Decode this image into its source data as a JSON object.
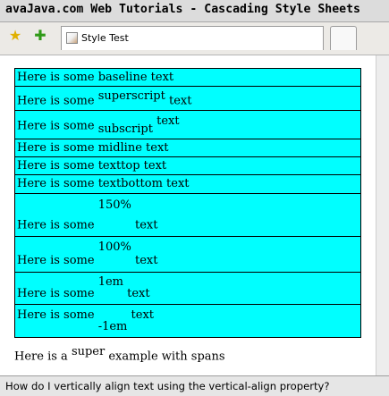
{
  "window": {
    "title": "avaJava.com Web Tutorials - Cascading Style Sheets"
  },
  "toolbar": {
    "star_icon": "star-icon",
    "add_icon": "plus-icon"
  },
  "tab": {
    "title": "Style Test",
    "favicon": "page-image-icon"
  },
  "demo_rows": [
    {
      "prefix": "Here is some",
      "value": "baseline text"
    },
    {
      "prefix": "Here is some",
      "value": "superscript",
      "suffix": "text"
    },
    {
      "prefix": "Here is some",
      "value": "subscript",
      "suffix": "text"
    },
    {
      "prefix": "Here is some",
      "value": "midline text"
    },
    {
      "prefix": "Here is some",
      "value": "texttop text"
    },
    {
      "prefix": "Here is some",
      "value": "textbottom text"
    },
    {
      "prefix": "Here is some",
      "value": "150%",
      "suffix": "text"
    },
    {
      "prefix": "Here is some",
      "value": "100%",
      "suffix": "text"
    },
    {
      "prefix": "Here is some",
      "value": "1em",
      "suffix": "text"
    },
    {
      "prefix": "Here is some",
      "value": "-1em",
      "suffix": "text"
    }
  ],
  "span_example": {
    "before": "Here is a",
    "sup": "super",
    "after": "example with spans"
  },
  "statusbar": {
    "text": "How do I vertically align text using the vertical-align property?"
  }
}
